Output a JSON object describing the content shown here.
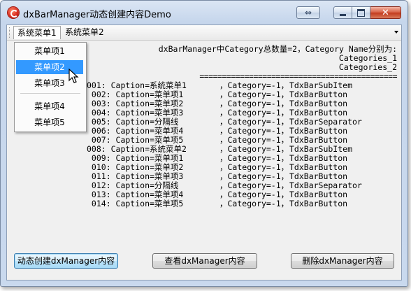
{
  "window": {
    "title": "dxBarManager动态创建内容Demo",
    "buttons": [
      "swap",
      "minimize",
      "maximize",
      "close"
    ]
  },
  "menubar": {
    "items": [
      {
        "label": "系统菜单1",
        "active": true
      },
      {
        "label": "系统菜单2",
        "active": false
      }
    ]
  },
  "dropdown": {
    "items": [
      {
        "label": "菜单项1",
        "hover": false
      },
      {
        "label": "菜单项2",
        "hover": true
      },
      {
        "label": "菜单项3",
        "hover": false
      },
      {
        "label": "菜单项4",
        "hover": false
      },
      {
        "label": "菜单项5",
        "hover": false
      }
    ]
  },
  "output": {
    "header_lines": [
      "dxBarManager中Category总数量=2，Category Name分别为:",
      "Categories_1",
      "Categories_2",
      "============================================"
    ],
    "rows": [
      {
        "caption": "001: Caption=系统菜单1",
        "category": "，Category=-1，",
        "cls": "TdxBarSubItem"
      },
      {
        "caption": " 002: Caption=菜单项1",
        "category": "，Category=-1，",
        "cls": "TdxBarButton"
      },
      {
        "caption": " 003: Caption=菜单项2",
        "category": "，Category=-1，",
        "cls": "TdxBarButton"
      },
      {
        "caption": " 004: Caption=菜单项3",
        "category": "，Category=-1，",
        "cls": "TdxBarButton"
      },
      {
        "caption": " 005: Caption=分隔线",
        "category": "，Category=-1，",
        "cls": "TdxBarSeparator"
      },
      {
        "caption": " 006: Caption=菜单项4",
        "category": "，Category=-1，",
        "cls": "TdxBarButton"
      },
      {
        "caption": " 007: Caption=菜单项5",
        "category": "，Category=-1，",
        "cls": "TdxBarButton"
      },
      {
        "caption": "008: Caption=系统菜单2",
        "category": "，Category=-1，",
        "cls": "TdxBarSubItem"
      },
      {
        "caption": " 009: Caption=菜单项1",
        "category": "，Category=-1，",
        "cls": "TdxBarButton"
      },
      {
        "caption": " 010: Caption=菜单项2",
        "category": "，Category=-1，",
        "cls": "TdxBarButton"
      },
      {
        "caption": " 011: Caption=菜单项3",
        "category": "，Category=-1，",
        "cls": "TdxBarButton"
      },
      {
        "caption": " 012: Caption=分隔线",
        "category": "，Category=-1，",
        "cls": "TdxBarSeparator"
      },
      {
        "caption": " 013: Caption=菜单项4",
        "category": "，Category=-1，",
        "cls": "TdxBarButton"
      },
      {
        "caption": " 014: Caption=菜单项5",
        "category": "，Category=-1，",
        "cls": "TdxBarButton"
      }
    ]
  },
  "buttons": {
    "create_label": "动态创建dxManager内容",
    "view_label": "查看dxManager内容",
    "delete_label": "删除dxManager内容"
  },
  "colors": {
    "highlight": "#3399ff",
    "close_button": "#c33d1f"
  }
}
